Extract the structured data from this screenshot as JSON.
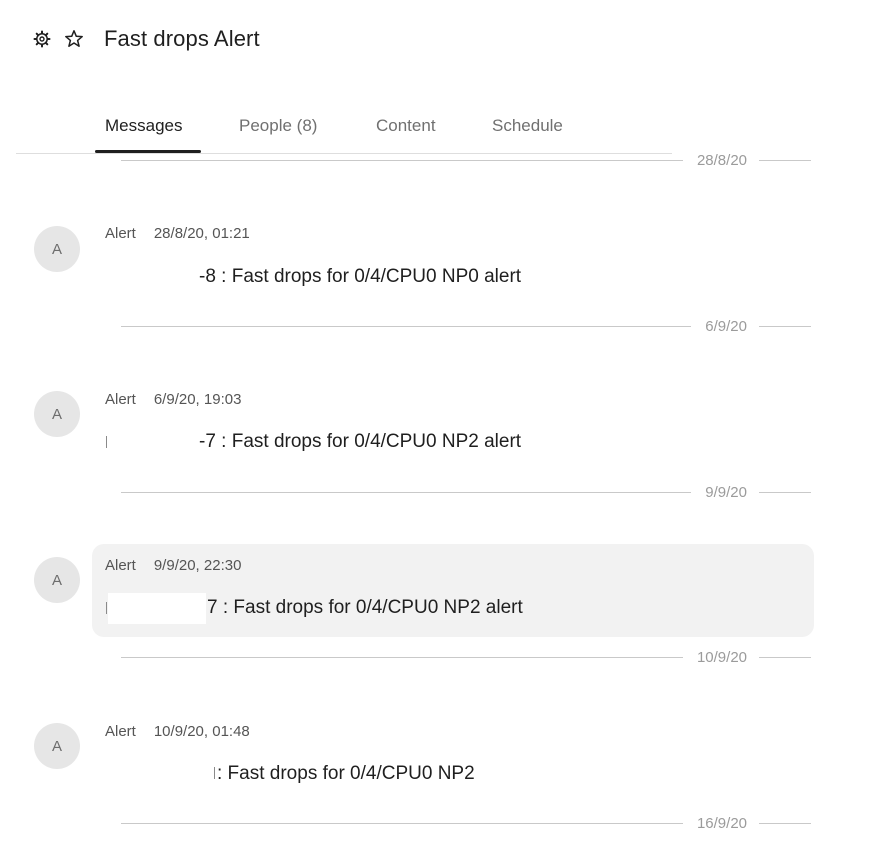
{
  "header": {
    "settings_icon": "gear-icon",
    "favorite_icon": "star-outline-icon",
    "title": "Fast drops Alert"
  },
  "tabs": [
    {
      "label": "Messages",
      "active": true
    },
    {
      "label": "People (8)",
      "active": false
    },
    {
      "label": "Content",
      "active": false
    },
    {
      "label": "Schedule",
      "active": false
    }
  ],
  "feed": {
    "date_separators": [
      "28/8/20",
      "6/9/20",
      "9/9/20",
      "10/9/20",
      "16/9/20"
    ],
    "messages": [
      {
        "avatar_initial": "A",
        "sender": "Alert",
        "timestamp": "28/8/20, 01:21",
        "text": "-8 : Fast drops for 0/4/CPU0 NP0 alert",
        "highlighted": false
      },
      {
        "avatar_initial": "A",
        "sender": "Alert",
        "timestamp": "6/9/20, 19:03",
        "text": "-7 : Fast drops for 0/4/CPU0 NP2 alert",
        "highlighted": false
      },
      {
        "avatar_initial": "A",
        "sender": "Alert",
        "timestamp": "9/9/20, 22:30",
        "text": "7 : Fast drops for 0/4/CPU0 NP2 alert",
        "highlighted": true
      },
      {
        "avatar_initial": "A",
        "sender": "Alert",
        "timestamp": "10/9/20, 01:48",
        "text": ": Fast drops for 0/4/CPU0 NP2",
        "highlighted": false
      }
    ]
  },
  "colors": {
    "text_primary": "#1f1f1f",
    "text_secondary": "#707070",
    "separator": "#c9c9c9",
    "avatar_bg": "#e6e6e6",
    "highlight_bg": "#f2f2f2"
  }
}
